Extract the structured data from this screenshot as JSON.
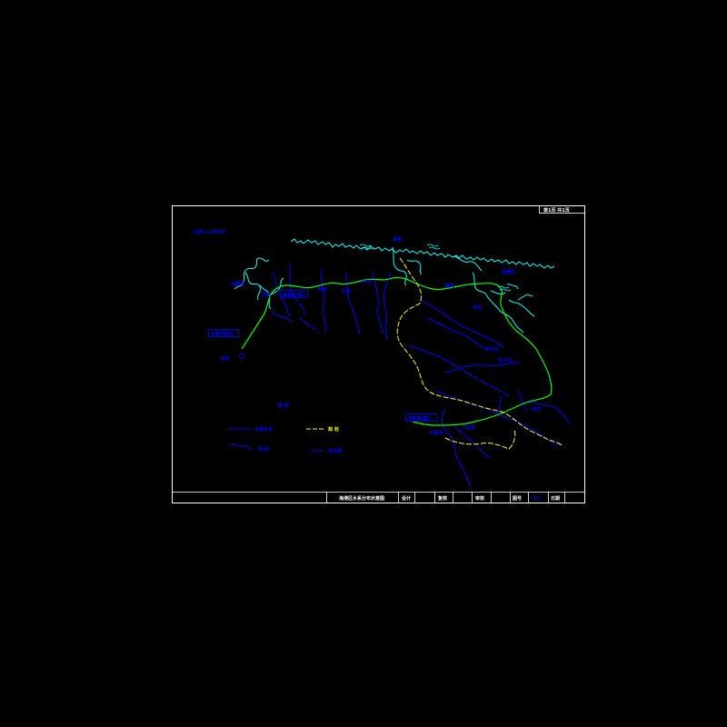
{
  "sheet": {
    "page_tag": "第1页 共1页",
    "scale_note": "比例 1:10000",
    "legend_title": "图 例",
    "legend_items": [
      {
        "key": "river",
        "label": "河流水系"
      },
      {
        "key": "yellow_line",
        "label": "规 划"
      },
      {
        "key": "shore",
        "label": "岸 线"
      },
      {
        "key": "blue_line",
        "label": "排水渠"
      }
    ],
    "title_block": {
      "drawing_title": "海港区水系分布示意图",
      "design": "设计",
      "review": "复核",
      "check": "审核",
      "drawing_no_label": "图号",
      "drawing_no_value": "01",
      "date_label": "日期"
    }
  },
  "map": {
    "place_labels": [
      {
        "id": "n1",
        "text": "渤海"
      },
      {
        "id": "n2",
        "text": "海港区"
      },
      {
        "id": "n3",
        "text": "北戴河"
      },
      {
        "id": "n4",
        "text": "汤河"
      },
      {
        "id": "n5",
        "text": "新河"
      },
      {
        "id": "n6",
        "text": "石河"
      },
      {
        "id": "n7",
        "text": "沙河"
      },
      {
        "id": "n8",
        "text": "戴河"
      },
      {
        "id": "n9",
        "text": "洋河"
      },
      {
        "id": "n10",
        "text": "饮马河"
      },
      {
        "id": "n11",
        "text": "起点"
      },
      {
        "id": "n12",
        "text": "终点"
      },
      {
        "id": "n13",
        "text": "人造河"
      },
      {
        "id": "n14",
        "text": "大蒲河"
      },
      {
        "id": "n15",
        "text": "东沙河"
      }
    ],
    "boxed_labels": [
      {
        "id": "b1",
        "text": "北戴河新区"
      },
      {
        "id": "b2",
        "text": "秦皇岛市区"
      },
      {
        "id": "b3",
        "text": "昌黎县城区"
      }
    ]
  },
  "colors": {
    "background": "#000000",
    "frame": "#ffffff",
    "coastline": "#00ffff",
    "river": "#0000ff",
    "green_route": "#00ff00",
    "yellow_route": "#ffff00",
    "label": "#0000ff"
  }
}
